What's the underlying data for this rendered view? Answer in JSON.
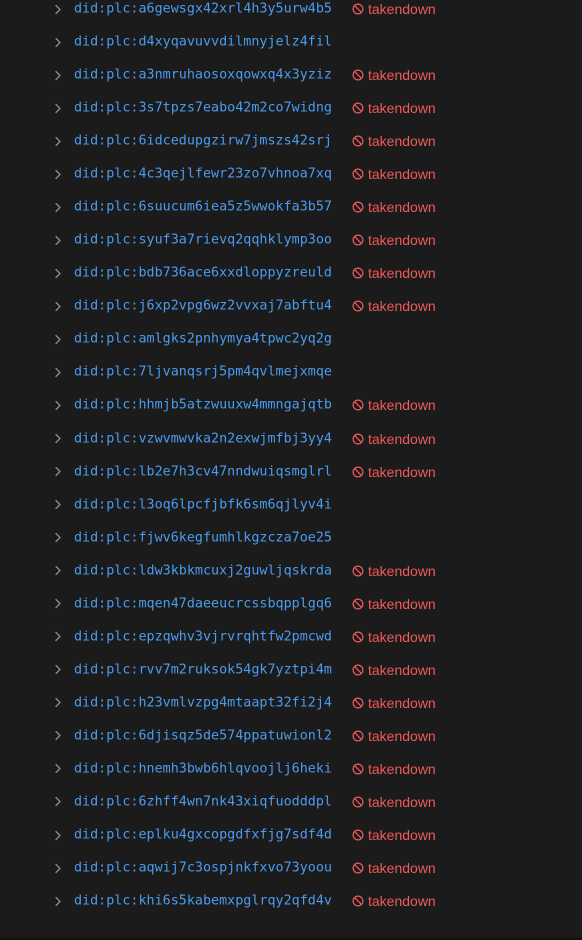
{
  "colors": {
    "background": "#1b1b1b",
    "did_text": "#4a9cf0",
    "takendown": "#ef5a5a",
    "chevron": "#8a8a8a"
  },
  "icons": {
    "expand": "chevron-right-icon",
    "badge": "ban-icon"
  },
  "badge_label": "takendown",
  "rows": [
    {
      "did": "did:plc:a6gewsgx42xrl4h3y5urw4b5",
      "takendown": true
    },
    {
      "did": "did:plc:d4xyqavuvvdilmnyjelz4fil",
      "takendown": false
    },
    {
      "did": "did:plc:a3nmruhaosoxqowxq4x3yziz",
      "takendown": true
    },
    {
      "did": "did:plc:3s7tpzs7eabo42m2co7widng",
      "takendown": true
    },
    {
      "did": "did:plc:6idcedupgzirw7jmszs42srj",
      "takendown": true
    },
    {
      "did": "did:plc:4c3qejlfewr23zo7vhnoa7xq",
      "takendown": true
    },
    {
      "did": "did:plc:6suucum6iea5z5wwokfa3b57",
      "takendown": true
    },
    {
      "did": "did:plc:syuf3a7rievq2qqhklymp3oo",
      "takendown": true
    },
    {
      "did": "did:plc:bdb736ace6xxdloppyzreuld",
      "takendown": true
    },
    {
      "did": "did:plc:j6xp2vpg6wz2vvxaj7abftu4",
      "takendown": true
    },
    {
      "did": "did:plc:amlgks2pnhymya4tpwc2yq2g",
      "takendown": false
    },
    {
      "did": "did:plc:7ljvanqsrj5pm4qvlmejxmqe",
      "takendown": false
    },
    {
      "did": "did:plc:hhmjb5atzwuuxw4mmngajqtb",
      "takendown": true
    },
    {
      "did": "did:plc:vzwvmwvka2n2exwjmfbj3yy4",
      "takendown": true
    },
    {
      "did": "did:plc:lb2e7h3cv47nndwuiqsmglrl",
      "takendown": true
    },
    {
      "did": "did:plc:l3oq6lpcfjbfk6sm6qjlyv4i",
      "takendown": false
    },
    {
      "did": "did:plc:fjwv6kegfumhlkgzcza7oe25",
      "takendown": false
    },
    {
      "did": "did:plc:ldw3kbkmcuxj2guwljqskrda",
      "takendown": true
    },
    {
      "did": "did:plc:mqen47daeeucrcssbqpplgq6",
      "takendown": true
    },
    {
      "did": "did:plc:epzqwhv3vjrvrqhtfw2pmcwd",
      "takendown": true
    },
    {
      "did": "did:plc:rvv7m2ruksok54gk7yztpi4m",
      "takendown": true
    },
    {
      "did": "did:plc:h23vmlvzpg4mtaapt32fi2j4",
      "takendown": true
    },
    {
      "did": "did:plc:6djisqz5de574ppatuwionl2",
      "takendown": true
    },
    {
      "did": "did:plc:hnemh3bwb6hlqvoojlj6heki",
      "takendown": true
    },
    {
      "did": "did:plc:6zhff4wn7nk43xiqfuodddpl",
      "takendown": true
    },
    {
      "did": "did:plc:eplku4gxcopgdfxfjg7sdf4d",
      "takendown": true
    },
    {
      "did": "did:plc:aqwij7c3ospjnkfxvo73yoou",
      "takendown": true
    },
    {
      "did": "did:plc:khi6s5kabemxpglrqy2qfd4v",
      "takendown": true
    }
  ]
}
